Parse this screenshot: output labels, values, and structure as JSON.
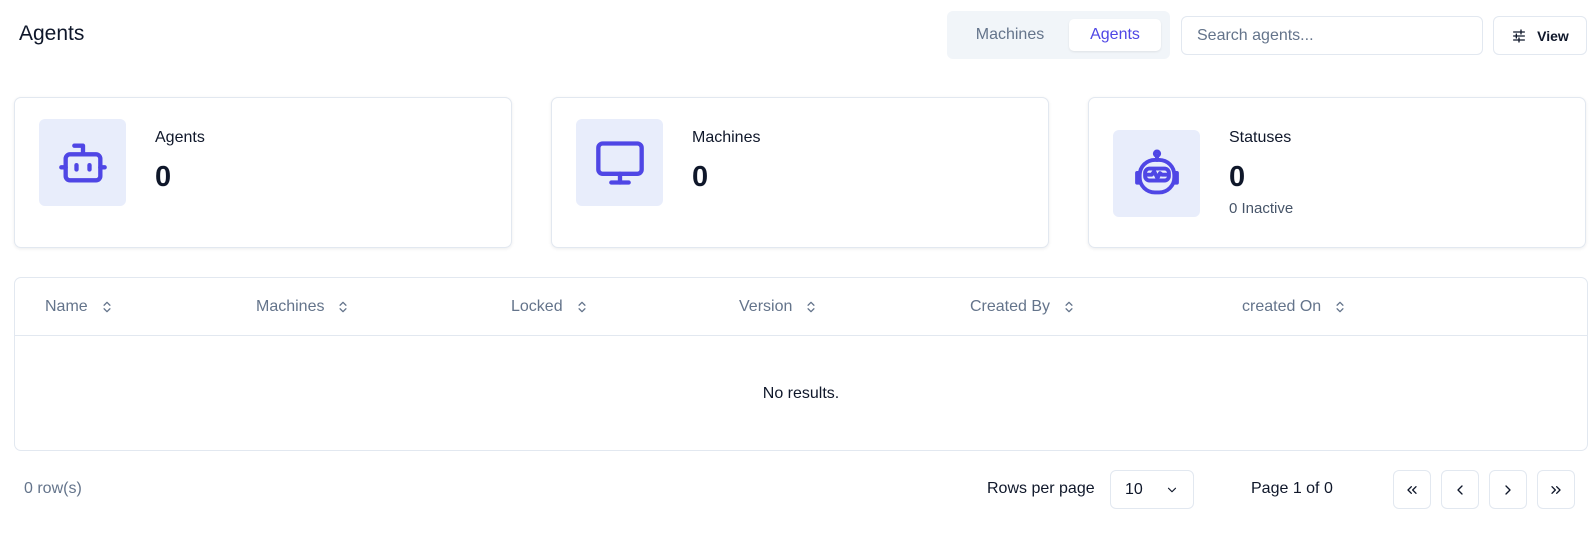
{
  "page": {
    "title": "Agents"
  },
  "view_switch": {
    "tabs": [
      "Machines",
      "Agents"
    ],
    "active": "Agents"
  },
  "search": {
    "placeholder": "Search agents...",
    "value": ""
  },
  "view_button": {
    "label": "View",
    "icon": "sliders-icon"
  },
  "stats": [
    {
      "label": "Agents",
      "value": "0",
      "icon": "bot-icon"
    },
    {
      "label": "Machines",
      "value": "0",
      "icon": "monitor-icon"
    },
    {
      "label": "Statuses",
      "value": "0",
      "sub": "0 Inactive",
      "icon": "robot-head-icon"
    }
  ],
  "table": {
    "columns": [
      "Name",
      "Machines",
      "Locked",
      "Version",
      "Created By",
      "created On"
    ],
    "rows": [],
    "empty_text": "No results."
  },
  "footer": {
    "row_count": "0 row(s)",
    "rows_per_page_label": "Rows per page",
    "rows_per_page_value": "10",
    "page_info": "Page 1 of 0"
  },
  "colors": {
    "accent": "#4f46e5",
    "icon_bg": "#e8edfb",
    "border": "#e2e8f0",
    "muted": "#64748b"
  }
}
